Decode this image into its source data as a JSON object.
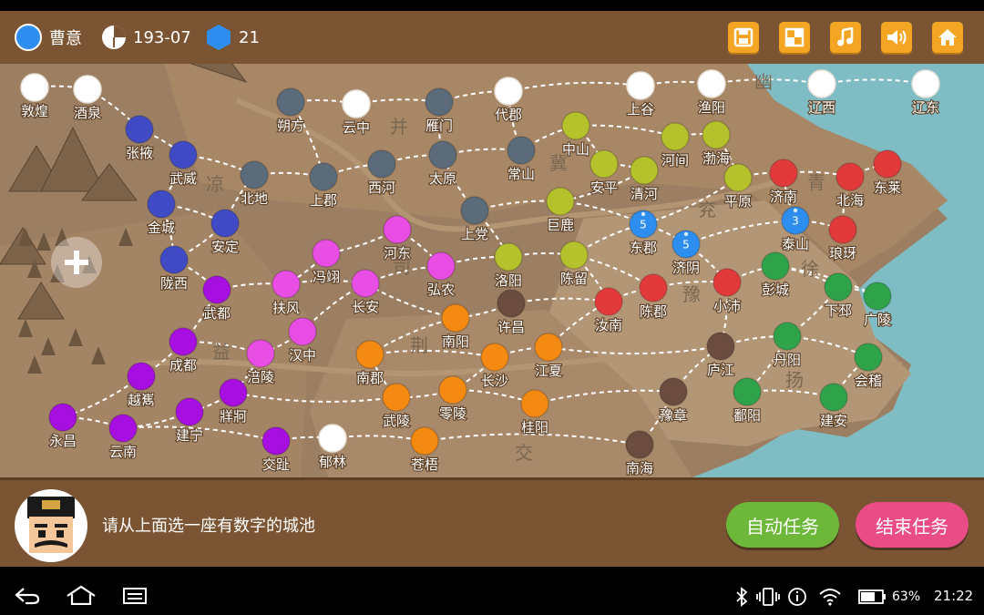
{
  "topbar": {
    "player_name": "曹意",
    "player_color": "#2d8ef0",
    "date": "193-07",
    "resource_count": "21",
    "buttons": [
      "save-icon",
      "layout-icon",
      "music-icon",
      "volume-icon",
      "home-icon"
    ]
  },
  "colors": {
    "white": "#ffffff",
    "gray": "#5b6b7a",
    "blue_navy": "#3f4ac4",
    "magenta": "#e84de4",
    "purple": "#a60fe0",
    "olive": "#b6c22c",
    "red": "#e23a3a",
    "brown": "#6b4c3f",
    "orange": "#f58a12",
    "green": "#2fa34a",
    "player_blue": "#2d8ef0"
  },
  "regions": [
    "幽",
    "并",
    "凉",
    "冀",
    "青",
    "兖",
    "徐",
    "司",
    "豫",
    "益",
    "荆",
    "扬",
    "交"
  ],
  "cities": [
    {
      "name": "敦煌",
      "c": "white"
    },
    {
      "name": "酒泉",
      "c": "white"
    },
    {
      "name": "张掖",
      "c": "blue_navy"
    },
    {
      "name": "武威",
      "c": "blue_navy"
    },
    {
      "name": "北地",
      "c": "gray"
    },
    {
      "name": "金城",
      "c": "blue_navy"
    },
    {
      "name": "安定",
      "c": "blue_navy"
    },
    {
      "name": "陇西",
      "c": "blue_navy"
    },
    {
      "name": "朔方",
      "c": "gray"
    },
    {
      "name": "云中",
      "c": "white"
    },
    {
      "name": "雁门",
      "c": "gray"
    },
    {
      "name": "代郡",
      "c": "white"
    },
    {
      "name": "上郡",
      "c": "gray"
    },
    {
      "name": "西河",
      "c": "gray"
    },
    {
      "name": "太原",
      "c": "gray"
    },
    {
      "name": "常山",
      "c": "gray"
    },
    {
      "name": "上党",
      "c": "gray"
    },
    {
      "name": "上谷",
      "c": "white"
    },
    {
      "name": "渔阳",
      "c": "white"
    },
    {
      "name": "辽西",
      "c": "white"
    },
    {
      "name": "辽东",
      "c": "white"
    },
    {
      "name": "中山",
      "c": "olive"
    },
    {
      "name": "河间",
      "c": "olive"
    },
    {
      "name": "渤海",
      "c": "olive"
    },
    {
      "name": "安平",
      "c": "olive"
    },
    {
      "name": "清河",
      "c": "olive"
    },
    {
      "name": "平原",
      "c": "olive"
    },
    {
      "name": "巨鹿",
      "c": "olive"
    },
    {
      "name": "济南",
      "c": "red"
    },
    {
      "name": "北海",
      "c": "red"
    },
    {
      "name": "东莱",
      "c": "red"
    },
    {
      "name": "东郡",
      "c": "player_blue",
      "n": "5"
    },
    {
      "name": "济阴",
      "c": "player_blue",
      "n": "5"
    },
    {
      "name": "泰山",
      "c": "player_blue",
      "n": "3"
    },
    {
      "name": "琅玡",
      "c": "red"
    },
    {
      "name": "河东",
      "c": "magenta"
    },
    {
      "name": "冯翊",
      "c": "magenta"
    },
    {
      "name": "弘农",
      "c": "magenta"
    },
    {
      "name": "扶风",
      "c": "magenta"
    },
    {
      "name": "长安",
      "c": "magenta"
    },
    {
      "name": "洛阳",
      "c": "olive"
    },
    {
      "name": "陈留",
      "c": "olive"
    },
    {
      "name": "陈郡",
      "c": "red"
    },
    {
      "name": "小沛",
      "c": "red"
    },
    {
      "name": "彭城",
      "c": "green"
    },
    {
      "name": "下邳",
      "c": "green"
    },
    {
      "name": "广陵",
      "c": "green"
    },
    {
      "name": "武都",
      "c": "purple"
    },
    {
      "name": "汉中",
      "c": "magenta"
    },
    {
      "name": "许昌",
      "c": "brown"
    },
    {
      "name": "汝南",
      "c": "red"
    },
    {
      "name": "南阳",
      "c": "orange"
    },
    {
      "name": "成都",
      "c": "purple"
    },
    {
      "name": "涪陵",
      "c": "magenta"
    },
    {
      "name": "南郡",
      "c": "orange"
    },
    {
      "name": "长沙",
      "c": "orange"
    },
    {
      "name": "江夏",
      "c": "orange"
    },
    {
      "name": "庐江",
      "c": "brown"
    },
    {
      "name": "丹阳",
      "c": "green"
    },
    {
      "name": "会稽",
      "c": "green"
    },
    {
      "name": "越嶲",
      "c": "purple"
    },
    {
      "name": "牂牁",
      "c": "purple"
    },
    {
      "name": "建宁",
      "c": "purple"
    },
    {
      "name": "永昌",
      "c": "purple"
    },
    {
      "name": "云南",
      "c": "purple"
    },
    {
      "name": "武陵",
      "c": "orange"
    },
    {
      "name": "零陵",
      "c": "orange"
    },
    {
      "name": "桂阳",
      "c": "orange"
    },
    {
      "name": "豫章",
      "c": "brown"
    },
    {
      "name": "鄱阳",
      "c": "green"
    },
    {
      "name": "建安",
      "c": "green"
    },
    {
      "name": "交趾",
      "c": "purple"
    },
    {
      "name": "郁林",
      "c": "white"
    },
    {
      "name": "苍梧",
      "c": "orange"
    },
    {
      "name": "南海",
      "c": "brown"
    }
  ],
  "bottom": {
    "hint": "请从上面选一座有数字的城池",
    "auto_task": "自动任务",
    "end_task": "结束任务"
  },
  "statusbar": {
    "battery": "63%",
    "time": "21:22"
  }
}
